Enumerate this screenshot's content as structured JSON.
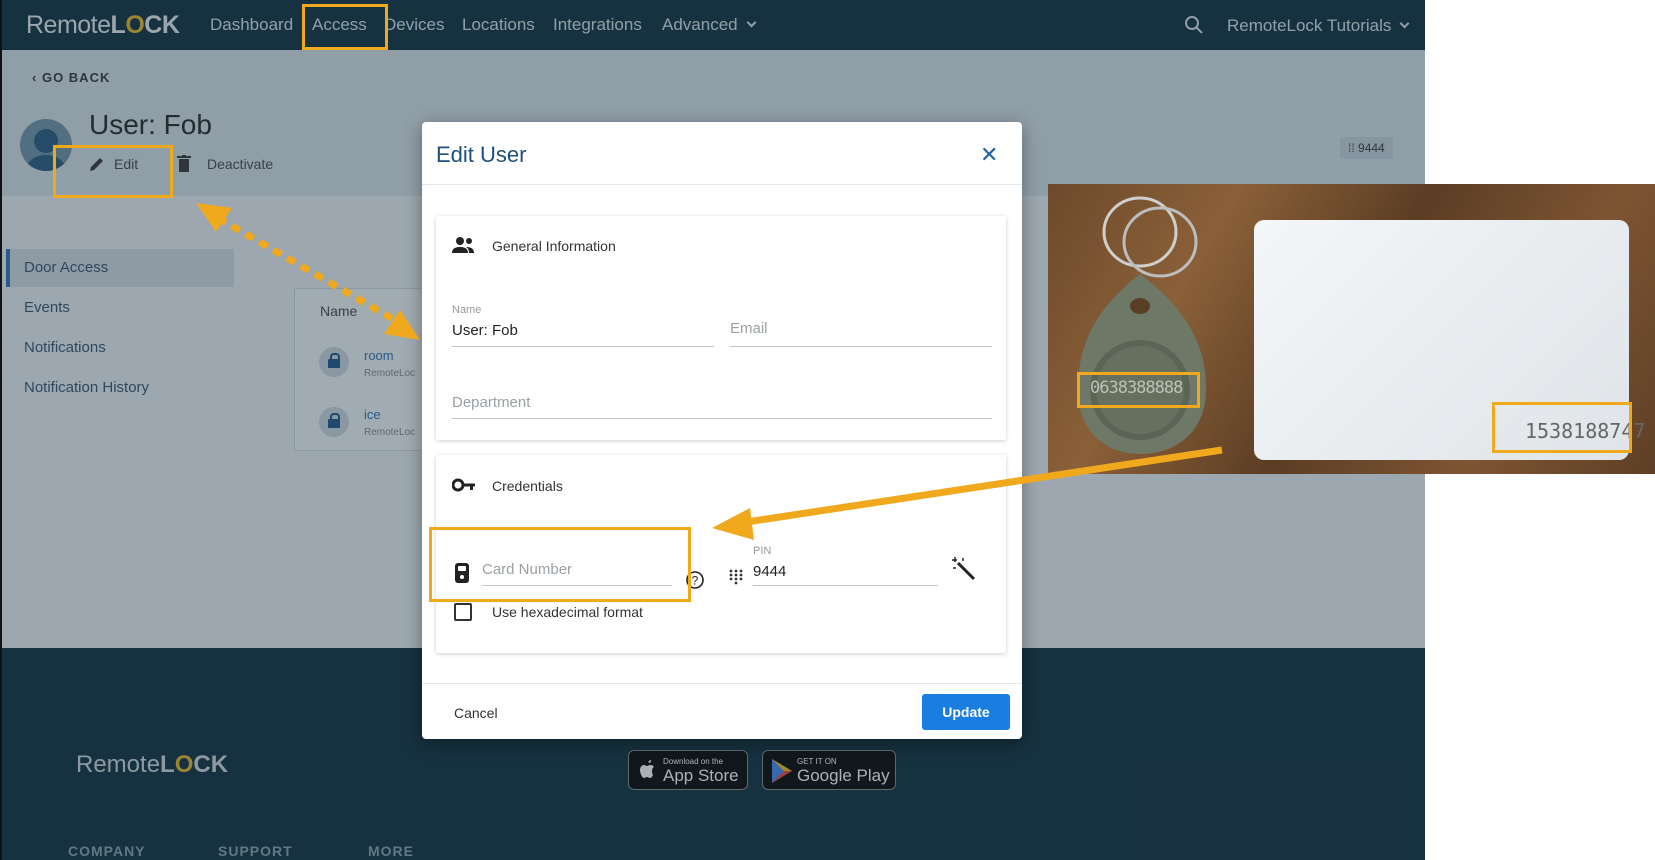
{
  "nav": {
    "logo_left": "Remote",
    "logo_o": "O",
    "logo_right": "CK",
    "items": [
      "Dashboard",
      "Access",
      "Devices",
      "Locations",
      "Integrations",
      "Advanced"
    ],
    "account": "RemoteLock Tutorials"
  },
  "page": {
    "go_back": "GO BACK",
    "title": "User: Fob",
    "edit": "Edit",
    "deactivate": "Deactivate",
    "pin_badge": "9444"
  },
  "sidebar": {
    "items": [
      "Door Access",
      "Events",
      "Notifications",
      "Notification History"
    ]
  },
  "table": {
    "header": "Name",
    "rows": [
      {
        "name": "room",
        "sub": "RemoteLoc"
      },
      {
        "name": "ice",
        "sub": "RemoteLoc"
      }
    ]
  },
  "modal": {
    "title": "Edit User",
    "general_header": "General Information",
    "name_label": "Name",
    "name_value": "User: Fob",
    "email_placeholder": "Email",
    "department_placeholder": "Department",
    "credentials_header": "Credentials",
    "card_placeholder": "Card Number",
    "pin_label": "PIN",
    "pin_value": "9444",
    "hex_label": "Use hexadecimal format",
    "cancel": "Cancel",
    "update": "Update"
  },
  "footer": {
    "logo_left": "Remote",
    "logo_o": "O",
    "logo_right": "CK",
    "appstore_small": "Download on the",
    "appstore_big": "App Store",
    "googleplay_small": "GET IT ON",
    "googleplay_big": "Google Play",
    "columns": [
      "COMPANY",
      "SUPPORT",
      "MORE"
    ]
  },
  "photo": {
    "card_number": "1538188747",
    "fob_number": "0638388888"
  },
  "colors": {
    "highlight": "#f0a81c",
    "nav_bg": "#0b2a38",
    "primary": "#1a7de0"
  }
}
